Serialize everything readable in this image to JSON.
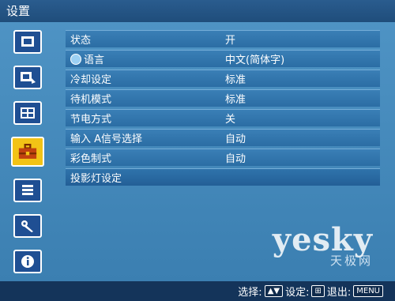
{
  "window": {
    "title": "设置"
  },
  "sidebar": {
    "icons": [
      {
        "name": "picture-icon"
      },
      {
        "name": "image-adjust-icon"
      },
      {
        "name": "screen-icon"
      },
      {
        "name": "toolbox-icon",
        "selected": true
      },
      {
        "name": "list-icon"
      },
      {
        "name": "wrench-icon"
      },
      {
        "name": "info-icon"
      }
    ]
  },
  "menu": {
    "items": [
      {
        "label": "状态",
        "value": "开"
      },
      {
        "label": "语言",
        "value": "中文(简体字)"
      },
      {
        "label": "冷却设定",
        "value": "标准"
      },
      {
        "label": "待机模式",
        "value": "标准"
      },
      {
        "label": "节电方式",
        "value": "关"
      },
      {
        "label": "输入 A信号选择",
        "value": "自动"
      },
      {
        "label": "彩色制式",
        "value": "自动"
      },
      {
        "label": "投影灯设定",
        "value": ""
      }
    ]
  },
  "footer": {
    "select_label": "选择:",
    "set_label": "设定:",
    "exit_label": "退出:",
    "exit_key": "MENU"
  },
  "watermark": {
    "brand": "yesky",
    "sub": "天极网"
  }
}
